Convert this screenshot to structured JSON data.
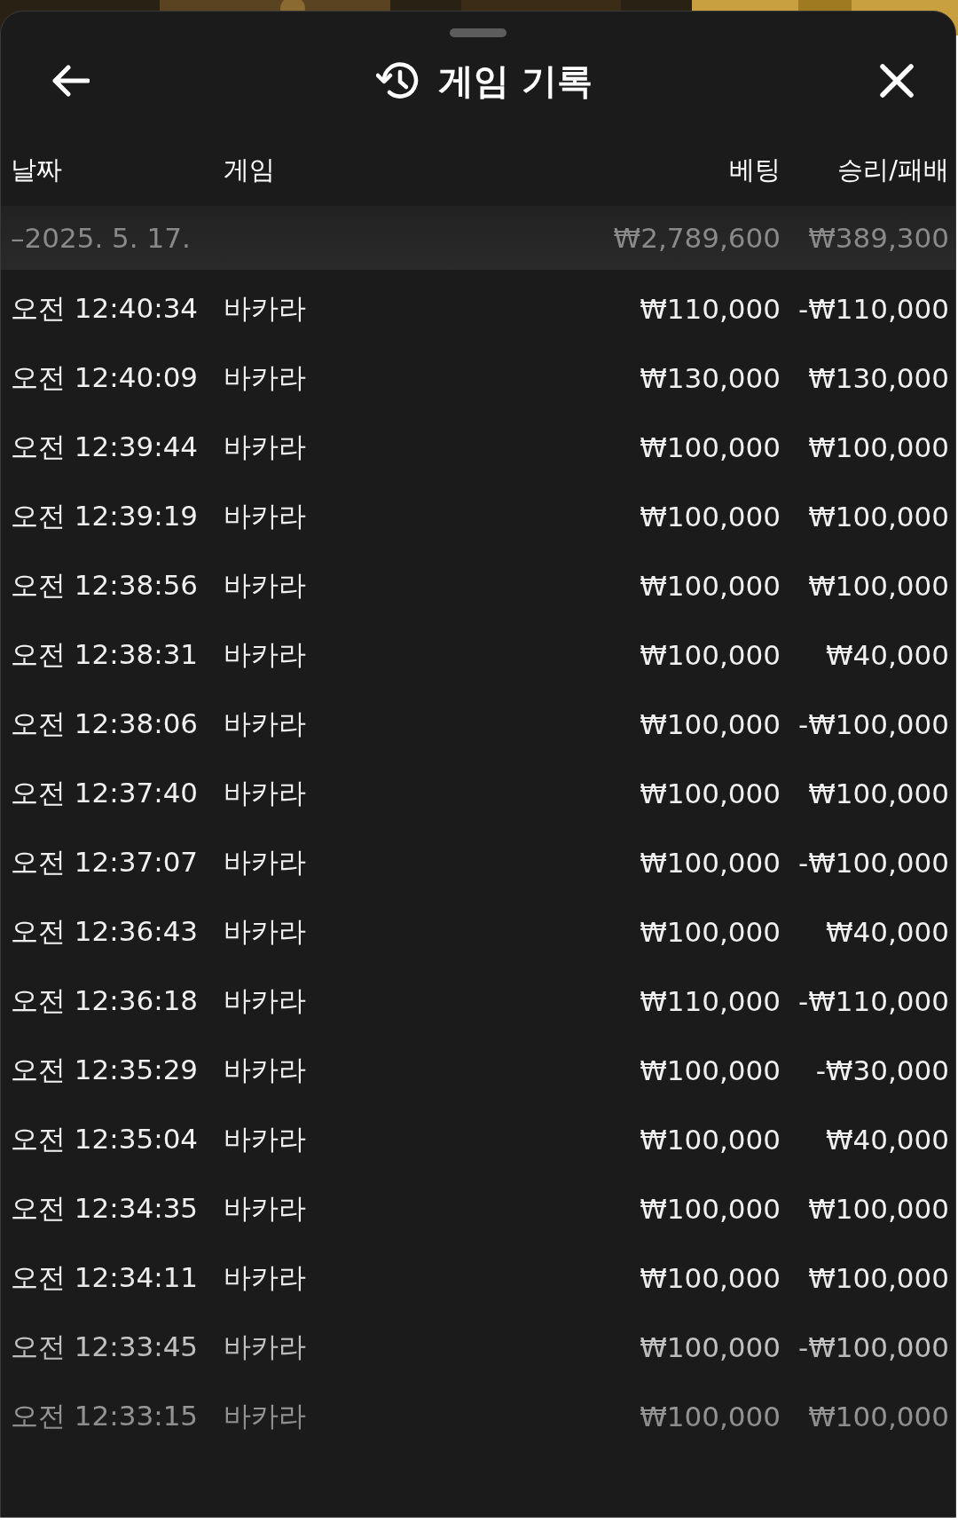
{
  "header": {
    "title": "게임 기록"
  },
  "columns": [
    "날짜",
    "게임",
    "베팅",
    "승리/패배"
  ],
  "date_group": {
    "date": "–2025. 5. 17.",
    "total_bet": "₩2,789,600",
    "total_result": "₩389,300"
  },
  "rows": [
    {
      "time": "오전 12:40:34",
      "game": "바카라",
      "bet": "₩110,000",
      "result": "-₩110,000"
    },
    {
      "time": "오전 12:40:09",
      "game": "바카라",
      "bet": "₩130,000",
      "result": "₩130,000"
    },
    {
      "time": "오전 12:39:44",
      "game": "바카라",
      "bet": "₩100,000",
      "result": "₩100,000"
    },
    {
      "time": "오전 12:39:19",
      "game": "바카라",
      "bet": "₩100,000",
      "result": "₩100,000"
    },
    {
      "time": "오전 12:38:56",
      "game": "바카라",
      "bet": "₩100,000",
      "result": "₩100,000"
    },
    {
      "time": "오전 12:38:31",
      "game": "바카라",
      "bet": "₩100,000",
      "result": "₩40,000"
    },
    {
      "time": "오전 12:38:06",
      "game": "바카라",
      "bet": "₩100,000",
      "result": "-₩100,000"
    },
    {
      "time": "오전 12:37:40",
      "game": "바카라",
      "bet": "₩100,000",
      "result": "₩100,000"
    },
    {
      "time": "오전 12:37:07",
      "game": "바카라",
      "bet": "₩100,000",
      "result": "-₩100,000"
    },
    {
      "time": "오전 12:36:43",
      "game": "바카라",
      "bet": "₩100,000",
      "result": "₩40,000"
    },
    {
      "time": "오전 12:36:18",
      "game": "바카라",
      "bet": "₩110,000",
      "result": "-₩110,000"
    },
    {
      "time": "오전 12:35:29",
      "game": "바카라",
      "bet": "₩100,000",
      "result": "-₩30,000"
    },
    {
      "time": "오전 12:35:04",
      "game": "바카라",
      "bet": "₩100,000",
      "result": "₩40,000"
    },
    {
      "time": "오전 12:34:35",
      "game": "바카라",
      "bet": "₩100,000",
      "result": "₩100,000"
    },
    {
      "time": "오전 12:34:11",
      "game": "바카라",
      "bet": "₩100,000",
      "result": "₩100,000"
    },
    {
      "time": "오전 12:33:45",
      "game": "바카라",
      "bet": "₩100,000",
      "result": "-₩100,000"
    },
    {
      "time": "오전 12:33:15",
      "game": "바카라",
      "bet": "₩100,000",
      "result": "₩100,000"
    }
  ]
}
